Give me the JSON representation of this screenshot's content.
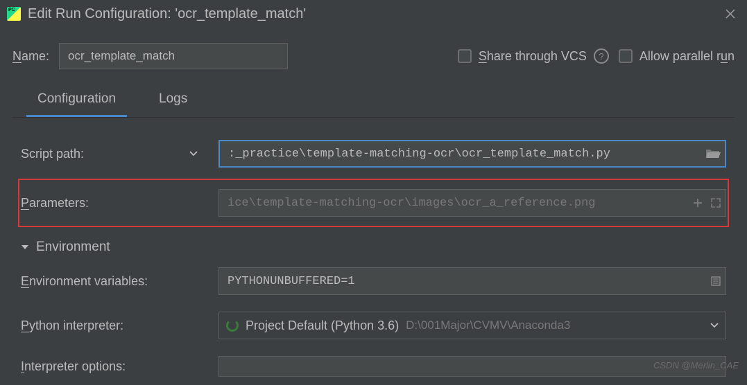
{
  "window": {
    "title": "Edit Run Configuration: 'ocr_template_match'"
  },
  "top": {
    "name_label": "Name:",
    "name_value": "ocr_template_match",
    "share_label": "Share through VCS",
    "allow_parallel_label": "Allow parallel run"
  },
  "tabs": {
    "configuration": "Configuration",
    "logs": "Logs"
  },
  "form": {
    "script_path_label": "Script path:",
    "script_path_value": ":_practice\\template-matching-ocr\\ocr_template_match.py",
    "parameters_label": "Parameters:",
    "parameters_placeholder": "ice\\template-matching-ocr\\images\\ocr_a_reference.png",
    "environment_header": "Environment",
    "env_vars_label": "Environment variables:",
    "env_vars_value": "PYTHONUNBUFFERED=1",
    "python_interp_label": "Python interpreter:",
    "python_interp_name": "Project Default (Python 3.6)",
    "python_interp_path": "D:\\001Major\\CVMV\\Anaconda3",
    "interp_options_label": "Interpreter options:"
  },
  "watermark": "CSDN @Merlin_CAE"
}
